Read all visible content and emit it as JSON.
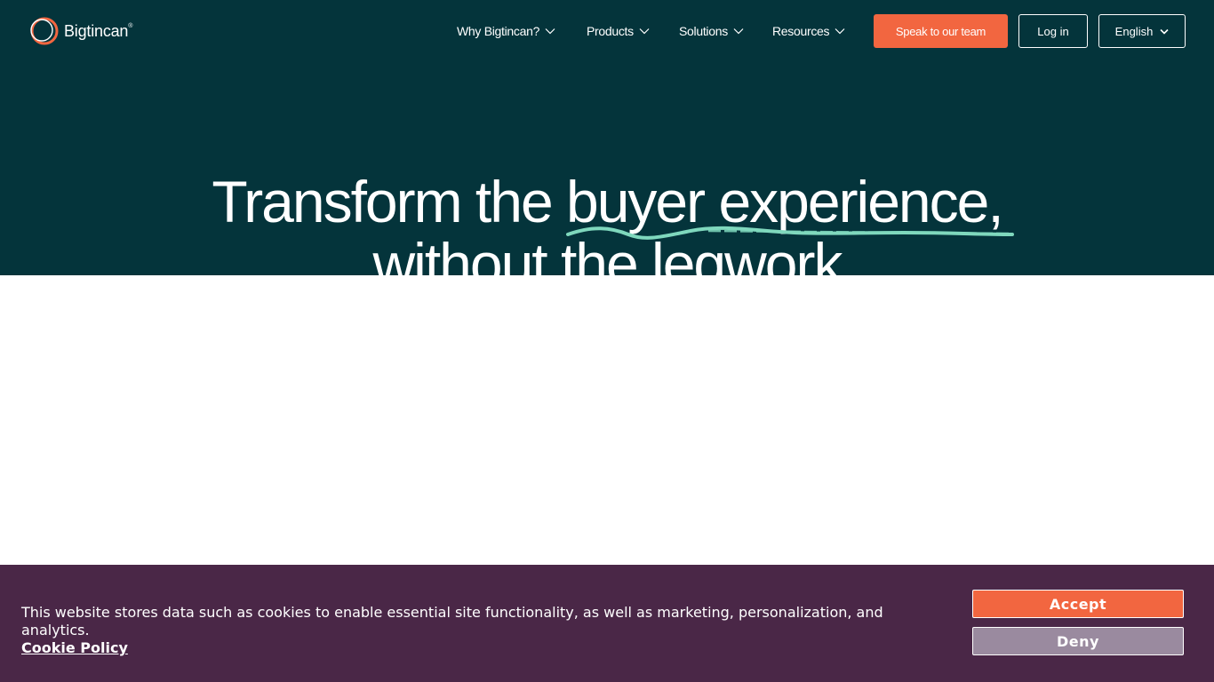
{
  "brand": {
    "name": "Bigtincan",
    "mark": "®"
  },
  "nav": {
    "items": [
      {
        "label": "Why Bigtincan?"
      },
      {
        "label": "Products"
      },
      {
        "label": "Solutions"
      },
      {
        "label": "Resources"
      }
    ],
    "cta_label": "Speak to our team",
    "login_label": "Log in",
    "language": "English"
  },
  "hero": {
    "headline_part1": "Transform the ",
    "headline_accent": "buyer experience,",
    "headline_line2": "without the legwork"
  },
  "cookie_banner": {
    "message": "This website stores data such as cookies to enable essential site functionality, as well as marketing, personalization, and analytics.",
    "policy_link": "Cookie Policy",
    "accept_label": "Accept",
    "deny_label": "Deny"
  },
  "colors": {
    "hero_bg": "#04343b",
    "accent_orange": "#f26640",
    "accent_mint": "#7fd8bd",
    "cookie_bg": "#4a2747",
    "deny_bg": "#9a8a9f"
  },
  "icons": {
    "logo": "circle-logo-icon",
    "chevron": "chevron-down-icon"
  }
}
